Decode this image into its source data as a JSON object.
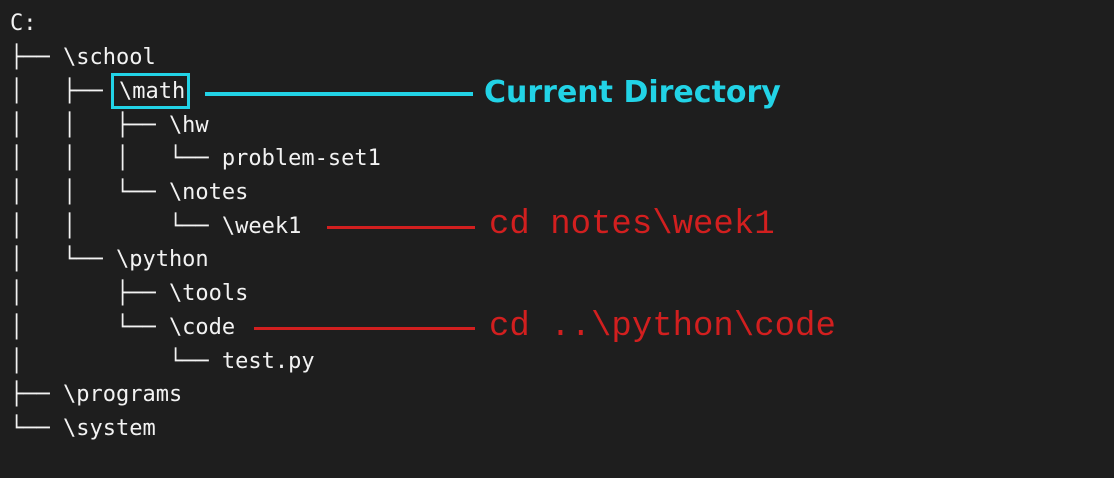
{
  "tree": {
    "lines": [
      "C:",
      "├── \\school",
      "│   ├──",
      "│   │   ├── \\hw",
      "│   │   │   └── problem-set1",
      "│   │   └── \\notes",
      "│   │       └── \\week1",
      "│   └── \\python",
      "│       ├── \\tools",
      "│       └── \\code",
      "│           └── test.py",
      "├── \\programs",
      "└── \\system"
    ],
    "current_directory": "\\math"
  },
  "annotations": {
    "current_directory_label": "Current Directory",
    "cd_week1": "cd notes\\week1",
    "cd_code": "cd ..\\python\\code"
  },
  "colors": {
    "background": "#1e1e1e",
    "tree_text": "#f2f2f2",
    "highlight": "#22d3e6",
    "command": "#d21f1f"
  }
}
